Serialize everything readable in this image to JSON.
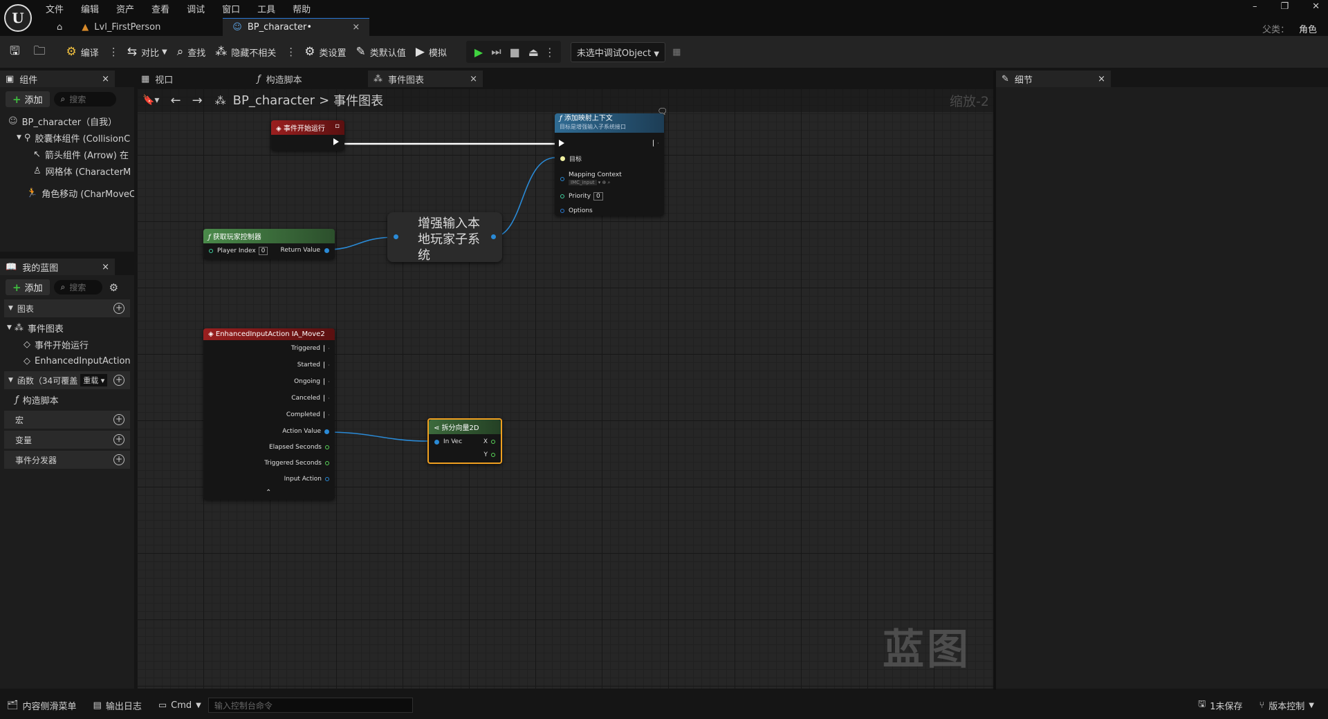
{
  "menu": [
    "文件",
    "编辑",
    "资产",
    "查看",
    "调试",
    "窗口",
    "工具",
    "帮助"
  ],
  "tabs": [
    {
      "label": "Lvl_FirstPerson",
      "active": false
    },
    {
      "label": "BP_character•",
      "active": true
    }
  ],
  "tab_close": "×",
  "window_controls": [
    "–",
    "❐",
    "✕"
  ],
  "parent": {
    "label": "父类：",
    "value": "角色"
  },
  "toolbar": {
    "compile": "编译",
    "diff": "对比",
    "find": "查找",
    "hide_unrelated": "隐藏不相关",
    "class_settings": "类设置",
    "class_defaults": "类默认值",
    "simulate": "模拟",
    "debug_object": "未选中调试Object"
  },
  "components_panel": {
    "title": "组件",
    "add": "添加",
    "search_placeholder": "搜索",
    "items": [
      {
        "label": "BP_character（自我）"
      },
      {
        "label": "胶囊体组件 (CollisionC"
      },
      {
        "label": "箭头组件 (Arrow) 在"
      },
      {
        "label": "网格体 (CharacterM"
      },
      {
        "label": "角色移动 (CharMoveC"
      }
    ]
  },
  "my_blueprint": {
    "title": "我的蓝图",
    "add": "添加",
    "search_placeholder": "搜索",
    "graphs": "图表",
    "event_graph": "事件图表",
    "event_items": [
      "事件开始运行",
      "EnhancedInputAction IA"
    ],
    "functions": "函数（34可覆盖",
    "override": "重载",
    "construction": "构造脚本",
    "macros": "宏",
    "variables": "变量",
    "dispatchers": "事件分发器"
  },
  "graph_tabs": {
    "viewport": "视口",
    "construction": "构造脚本",
    "event_graph": "事件图表"
  },
  "breadcrumb": {
    "root": "BP_character",
    "sep": ">",
    "current": "事件图表"
  },
  "zoom": "缩放-2",
  "watermark": "蓝图",
  "nodes": {
    "begin_play": {
      "title": "事件开始运行"
    },
    "add_mapping": {
      "title": "添加映射上下文",
      "subtitle": "目标是增强输入子系统接口",
      "target": "目标",
      "mapping_context": "Mapping Context",
      "mapping_value": "IMC_input",
      "priority": "Priority",
      "priority_value": "0",
      "options": "Options"
    },
    "get_controller": {
      "title": "获取玩家控制器",
      "player_index": "Player Index",
      "player_index_value": "0",
      "return_value": "Return Value"
    },
    "subsystem": {
      "title": "增强输入本地玩家子系统"
    },
    "input_action": {
      "title": "EnhancedInputAction IA_Move2",
      "pins": [
        "Triggered",
        "Started",
        "Ongoing",
        "Canceled",
        "Completed"
      ],
      "action_value": "Action Value",
      "elapsed": "Elapsed Seconds",
      "triggered_seconds": "Triggered Seconds",
      "input_action": "Input Action"
    },
    "break_vector": {
      "title": "拆分向量2D",
      "in": "In Vec",
      "x": "X",
      "y": "Y"
    }
  },
  "details": {
    "title": "细节"
  },
  "statusbar": {
    "content_drawer": "内容侧滑菜单",
    "output_log": "输出日志",
    "cmd": "Cmd",
    "cmd_placeholder": "输入控制台命令",
    "unsaved": "1未保存",
    "source_control": "版本控制"
  },
  "colors": {
    "accent": "#2a78d6",
    "event_red": "#8a1a1a",
    "function_blue": "#2a5a80",
    "pure_green": "#3c6a3c",
    "selected": "#f0a020",
    "wire_blue": "#2a8ad6",
    "exec_white": "#ffffff"
  }
}
